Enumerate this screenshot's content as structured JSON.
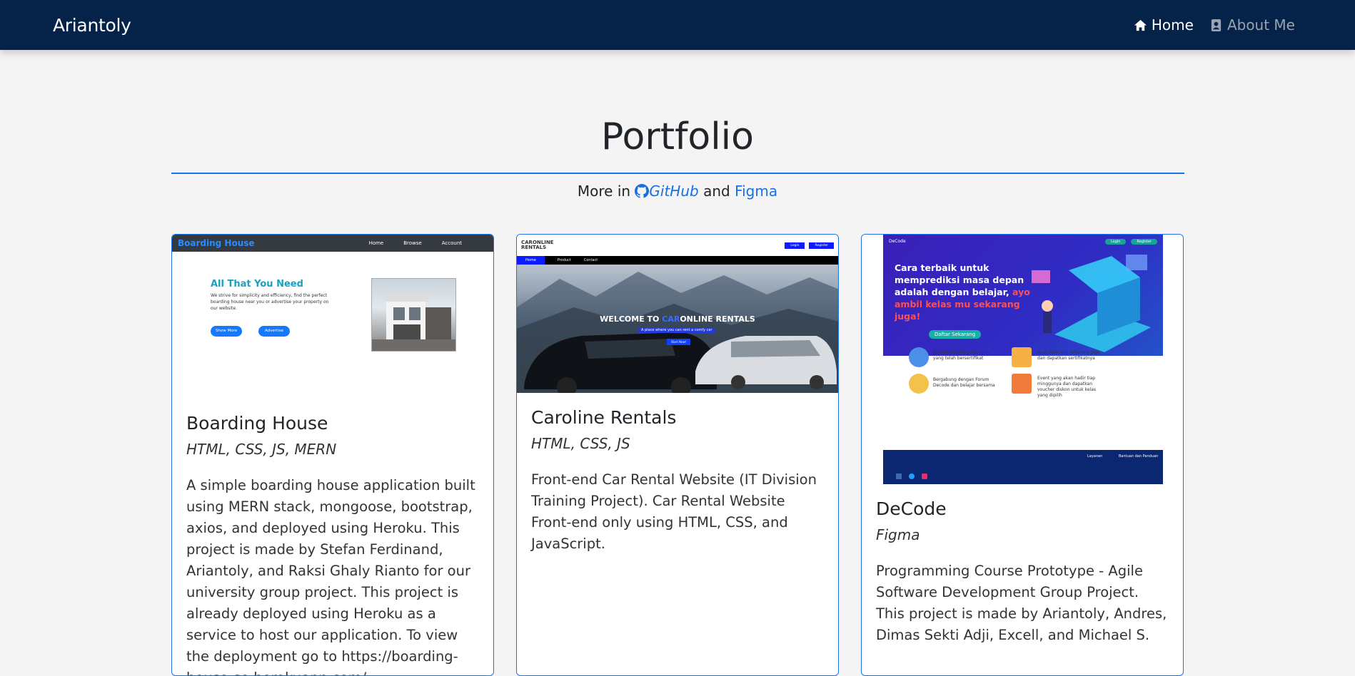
{
  "navbar": {
    "brand": "Ariantoly",
    "links": [
      {
        "label": "Home",
        "icon": "home-icon",
        "active": true
      },
      {
        "label": "About Me",
        "icon": "user-card-icon",
        "active": false
      }
    ]
  },
  "header": {
    "title": "Portfolio",
    "more_prefix": "More in",
    "github_label": "GitHub",
    "and_label": "and",
    "figma_label": "Figma"
  },
  "cards": [
    {
      "title": "Boarding House",
      "tags": "HTML, CSS, JS, MERN",
      "description": "A simple boarding house application built using MERN stack, mongoose, bootstrap, axios, and deployed using Heroku. This project is made by Stefan Ferdinand, Ariantoly, and Raksi Ghaly Rianto for our university group project. This project is already deployed using Heroku as a service to host our application. To view the deployment go to https://boarding-house-se.herokuapp.com/",
      "thumb": {
        "brand": "Boarding House",
        "nav": [
          "Home",
          "Browse",
          "Account"
        ],
        "hero_title": "All That You Need",
        "hero_text": "We strive for simplicity and efficiency, find the perfect boarding house near you or advertise your property on our website.",
        "btn1": "Show More",
        "btn2": "Advertise"
      }
    },
    {
      "title": "Caroline Rentals",
      "tags": "HTML, CSS, JS",
      "description": "Front-end Car Rental Website (IT Division Training Project). Car Rental Website Front-end only using HTML, CSS, and JavaScript.",
      "thumb": {
        "logo_line1": "CARONLINE",
        "logo_line2": "RENTALS",
        "btn_login": "Login",
        "btn_register": "Register",
        "menu": [
          "Home",
          "Product",
          "Contact"
        ],
        "welcome_prefix": "WELCOME TO",
        "welcome_car": "CAR",
        "welcome_rest": "ONLINE RENTALS",
        "subtitle": "A place where you can rent a comfy car",
        "start_btn": "Start Now!"
      }
    },
    {
      "title": "DeCode",
      "tags": "Figma",
      "description": "Programming Course Prototype - Agile Software Development Group Project. This project is made by Ariantoly, Andres, Dimas Sekti Adji, Excell, and Michael S.",
      "thumb": {
        "brand": "DeCode",
        "btn_login": "Login",
        "btn_register": "Register",
        "headline": "Cara terbaik untuk memprediksi masa depan adalah dengan belajar,",
        "headline_accent": "ayo ambil kelas mu sekarang juga!",
        "cta": "Daftar Sekarang",
        "features": [
          "Belajar langsung dari guru yang telah bersertifikat",
          "Buat sekarang sekarang juga dan dapatkan sertifikatnya",
          "Bergabung dengan Forum Decode dan belajar bersama",
          "Event yang akan hadir tiap minggunya dan dapatkan voucher diskon untuk kelas yang dipilih"
        ],
        "footer_col1": "Layanan",
        "footer_col2": "Bantuan dan Panduan"
      }
    }
  ],
  "colors": {
    "navbar_bg": "#052249",
    "accent": "#1a73e8",
    "page_bg": "#f4f4f4"
  }
}
